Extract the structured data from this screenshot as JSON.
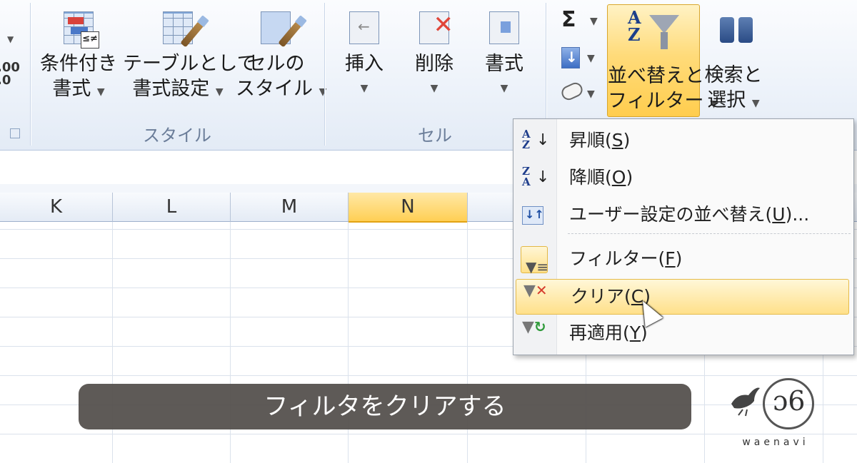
{
  "ribbon": {
    "number_fragment": ".00\n.0",
    "groups": [
      {
        "name": "style_group",
        "label": "スタイル"
      },
      {
        "name": "cells_group",
        "label": "セル"
      }
    ],
    "style_buttons": [
      {
        "line1": "条件付き",
        "line2": "書式"
      },
      {
        "line1": "テーブルとして",
        "line2": "書式設定"
      },
      {
        "line1": "セルの",
        "line2": "スタイル"
      }
    ],
    "cell_buttons": [
      {
        "label": "挿入"
      },
      {
        "label": "削除"
      },
      {
        "label": "書式"
      }
    ],
    "editing": {
      "sum_symbol": "Σ",
      "sort_line1": "並べ替えと",
      "sort_line2": "フィルター",
      "find_line1": "検索と",
      "find_line2": "選択"
    },
    "icons": {
      "sort_az": "A\nZ"
    }
  },
  "columns": [
    {
      "label": "K",
      "selected": false
    },
    {
      "label": "L",
      "selected": false
    },
    {
      "label": "M",
      "selected": false
    },
    {
      "label": "N",
      "selected": true
    }
  ],
  "menu": {
    "items": [
      {
        "label": "昇順(",
        "key": "S",
        "tail": ")",
        "icon": "sort-ascending-icon",
        "icon_text": "A\nZ"
      },
      {
        "label": "降順(",
        "key": "O",
        "tail": ")",
        "icon": "sort-descending-icon",
        "icon_text": "Z\nA"
      },
      {
        "label": "ユーザー設定の並べ替え(",
        "key": "U",
        "tail": ")...",
        "icon": "custom-sort-icon"
      },
      {
        "label": "フィルター(",
        "key": "F",
        "tail": ")",
        "icon": "filter-icon"
      },
      {
        "label": "クリア(",
        "key": "C",
        "tail": ")",
        "icon": "clear-filter-icon",
        "highlighted": true
      },
      {
        "label": "再適用(",
        "key": "Y",
        "tail": ")",
        "icon": "reapply-filter-icon"
      }
    ]
  },
  "caption": {
    "text": "フィルタをクリアする"
  },
  "logo": {
    "word": "waenavi",
    "mark": "ɔ6"
  },
  "colors": {
    "highlight": "#ffd96b",
    "caption_bg": "#524e4a",
    "accent_blue": "#1f3e8c"
  }
}
